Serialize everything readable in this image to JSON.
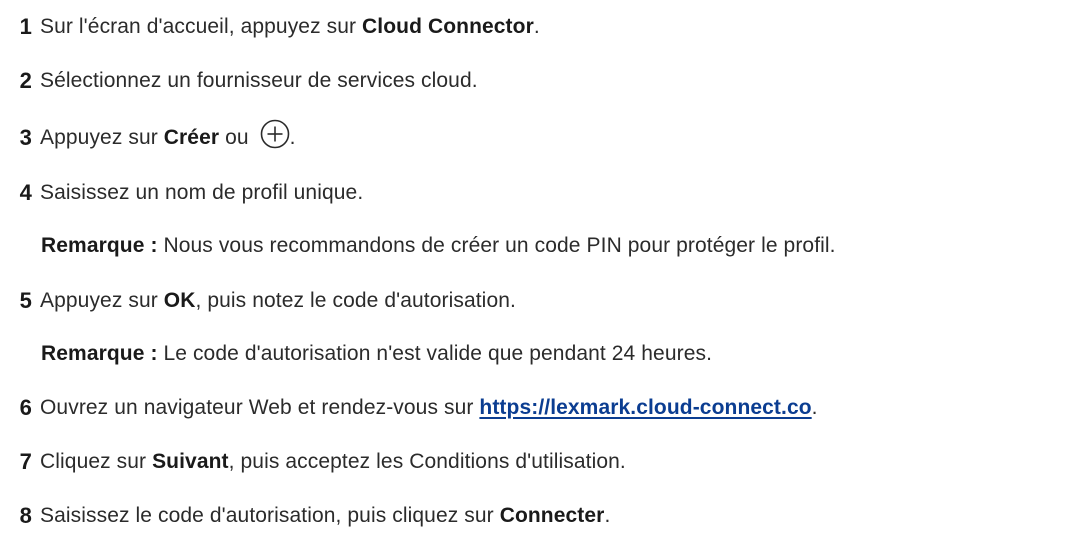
{
  "steps": [
    {
      "number": "1",
      "pre": "Sur l'écran d'accueil, appuyez sur ",
      "bold": "Cloud Connector",
      "post": "."
    },
    {
      "number": "2",
      "text": "Sélectionnez un fournisseur de services cloud."
    },
    {
      "number": "3",
      "pre": "Appuyez sur ",
      "bold": "Créer",
      "mid": " ou ",
      "post": ".",
      "icon": "plus-circle-icon"
    },
    {
      "number": "4",
      "text": "Saisissez un nom de profil unique.",
      "note": {
        "label": "Remarque :",
        "text": " Nous vous recommandons de créer un code PIN pour protéger le profil."
      }
    },
    {
      "number": "5",
      "pre": "Appuyez sur ",
      "bold": "OK",
      "post": ", puis notez le code d'autorisation.",
      "note": {
        "label": "Remarque :",
        "text": " Le code d'autorisation n'est valide que pendant 24 heures."
      }
    },
    {
      "number": "6",
      "pre": "Ouvrez un navigateur Web et rendez-vous sur ",
      "link": "https://lexmark.cloud-connect.co",
      "post": "."
    },
    {
      "number": "7",
      "pre": "Cliquez sur ",
      "bold": "Suivant",
      "post": ", puis acceptez les Conditions d'utilisation."
    },
    {
      "number": "8",
      "pre": "Saisissez le code d'autorisation, puis cliquez sur ",
      "bold": "Connecter",
      "post": "."
    }
  ],
  "colors": {
    "text": "#2b2b2b",
    "link": "#0b3d91"
  }
}
